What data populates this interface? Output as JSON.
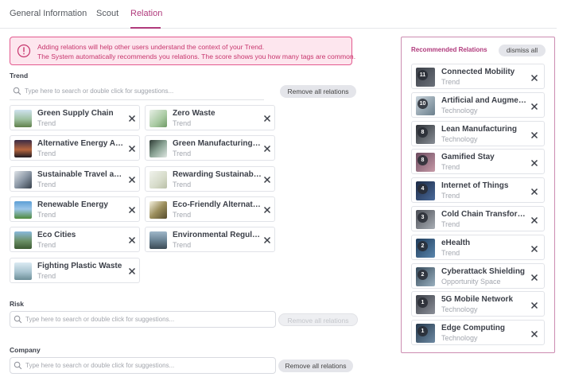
{
  "tabs": {
    "general": "General Information",
    "scout": "Scout",
    "relation": "Relation"
  },
  "alert": {
    "line1": "Adding relations will help other users understand the context of your Trend.",
    "line2": "The System automatically recommends you relations. The score shows you how many tags are common."
  },
  "trend": {
    "label": "Trend",
    "placeholder": "Type here to search or double click for suggestions...",
    "remove_all": "Remove all relations",
    "items": [
      {
        "title": "Green Supply Chain",
        "type": "Trend",
        "thumb": "photo-supply-chain-icon"
      },
      {
        "title": "Zero Waste",
        "type": "Trend",
        "thumb": "photo-zero-waste-icon"
      },
      {
        "title": "Alternative Energy Adoption",
        "type": "Trend",
        "thumb": "photo-sunset-energy-icon"
      },
      {
        "title": "Green Manufacturing Practices",
        "type": "Trend",
        "thumb": "photo-green-manufacturing-icon"
      },
      {
        "title": "Sustainable Travel and Tourism",
        "type": "Trend",
        "thumb": "photo-travel-icon"
      },
      {
        "title": "Rewarding Sustainable Behavior",
        "type": "Trend",
        "thumb": "photo-rewarding-icon"
      },
      {
        "title": "Renewable Energy",
        "type": "Trend",
        "thumb": "photo-renewable-icon"
      },
      {
        "title": "Eco-Friendly Alternatives",
        "type": "Trend",
        "thumb": "photo-eco-shoe-icon"
      },
      {
        "title": "Eco Cities",
        "type": "Trend",
        "thumb": "photo-eco-cities-icon"
      },
      {
        "title": "Environmental Regulations",
        "type": "Trend",
        "thumb": "photo-environment-icon"
      },
      {
        "title": "Fighting Plastic Waste",
        "type": "Trend",
        "thumb": "photo-plastic-icon"
      }
    ]
  },
  "risk": {
    "label": "Risk",
    "placeholder": "Type here to search or double click for suggestions...",
    "remove_all": "Remove all relations"
  },
  "company": {
    "label": "Company",
    "placeholder": "Type here to search or double click for suggestions...",
    "remove_all": "Remove all relations"
  },
  "recommended": {
    "title": "Recommended Relations",
    "dismiss_all": "dismiss all",
    "items": [
      {
        "score": "11",
        "title": "Connected Mobility",
        "type": "Trend"
      },
      {
        "score": "10",
        "title": "Artificial and Augmented Intelligence",
        "type": "Technology"
      },
      {
        "score": "8",
        "title": "Lean Manufacturing",
        "type": "Technology"
      },
      {
        "score": "8",
        "title": "Gamified Stay",
        "type": "Trend"
      },
      {
        "score": "4",
        "title": "Internet of Things",
        "type": "Trend"
      },
      {
        "score": "3",
        "title": "Cold Chain Transformation",
        "type": "Trend"
      },
      {
        "score": "2",
        "title": "eHealth",
        "type": "Trend"
      },
      {
        "score": "2",
        "title": "Cyberattack Shielding",
        "type": "Opportunity Space"
      },
      {
        "score": "1",
        "title": "5G Mobile Network",
        "type": "Technology"
      },
      {
        "score": "1",
        "title": "Edge Computing",
        "type": "Technology"
      }
    ]
  },
  "colors": {
    "accent": "#b03a7c",
    "alert_bg": "#fde6ee",
    "alert_border": "#e35a8f"
  }
}
